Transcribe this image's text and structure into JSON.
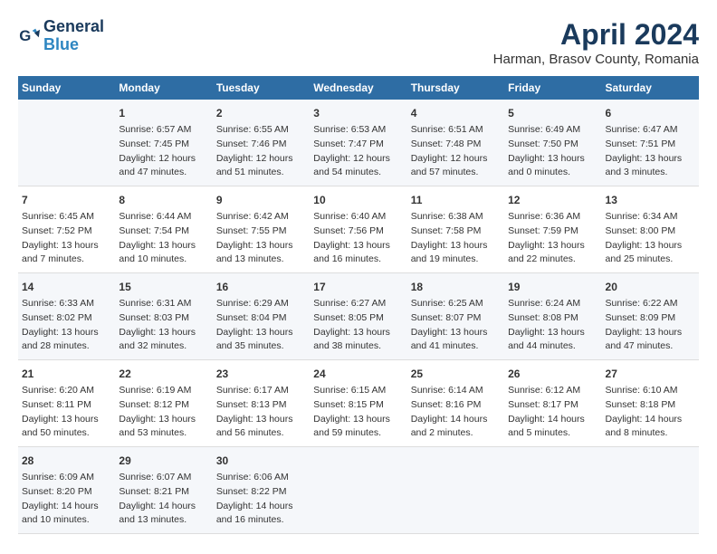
{
  "header": {
    "logo_line1": "General",
    "logo_line2": "Blue",
    "title": "April 2024",
    "subtitle": "Harman, Brasov County, Romania"
  },
  "days_of_week": [
    "Sunday",
    "Monday",
    "Tuesday",
    "Wednesday",
    "Thursday",
    "Friday",
    "Saturday"
  ],
  "weeks": [
    [
      {
        "day": "",
        "info": ""
      },
      {
        "day": "1",
        "info": "Sunrise: 6:57 AM\nSunset: 7:45 PM\nDaylight: 12 hours\nand 47 minutes."
      },
      {
        "day": "2",
        "info": "Sunrise: 6:55 AM\nSunset: 7:46 PM\nDaylight: 12 hours\nand 51 minutes."
      },
      {
        "day": "3",
        "info": "Sunrise: 6:53 AM\nSunset: 7:47 PM\nDaylight: 12 hours\nand 54 minutes."
      },
      {
        "day": "4",
        "info": "Sunrise: 6:51 AM\nSunset: 7:48 PM\nDaylight: 12 hours\nand 57 minutes."
      },
      {
        "day": "5",
        "info": "Sunrise: 6:49 AM\nSunset: 7:50 PM\nDaylight: 13 hours\nand 0 minutes."
      },
      {
        "day": "6",
        "info": "Sunrise: 6:47 AM\nSunset: 7:51 PM\nDaylight: 13 hours\nand 3 minutes."
      }
    ],
    [
      {
        "day": "7",
        "info": "Sunrise: 6:45 AM\nSunset: 7:52 PM\nDaylight: 13 hours\nand 7 minutes."
      },
      {
        "day": "8",
        "info": "Sunrise: 6:44 AM\nSunset: 7:54 PM\nDaylight: 13 hours\nand 10 minutes."
      },
      {
        "day": "9",
        "info": "Sunrise: 6:42 AM\nSunset: 7:55 PM\nDaylight: 13 hours\nand 13 minutes."
      },
      {
        "day": "10",
        "info": "Sunrise: 6:40 AM\nSunset: 7:56 PM\nDaylight: 13 hours\nand 16 minutes."
      },
      {
        "day": "11",
        "info": "Sunrise: 6:38 AM\nSunset: 7:58 PM\nDaylight: 13 hours\nand 19 minutes."
      },
      {
        "day": "12",
        "info": "Sunrise: 6:36 AM\nSunset: 7:59 PM\nDaylight: 13 hours\nand 22 minutes."
      },
      {
        "day": "13",
        "info": "Sunrise: 6:34 AM\nSunset: 8:00 PM\nDaylight: 13 hours\nand 25 minutes."
      }
    ],
    [
      {
        "day": "14",
        "info": "Sunrise: 6:33 AM\nSunset: 8:02 PM\nDaylight: 13 hours\nand 28 minutes."
      },
      {
        "day": "15",
        "info": "Sunrise: 6:31 AM\nSunset: 8:03 PM\nDaylight: 13 hours\nand 32 minutes."
      },
      {
        "day": "16",
        "info": "Sunrise: 6:29 AM\nSunset: 8:04 PM\nDaylight: 13 hours\nand 35 minutes."
      },
      {
        "day": "17",
        "info": "Sunrise: 6:27 AM\nSunset: 8:05 PM\nDaylight: 13 hours\nand 38 minutes."
      },
      {
        "day": "18",
        "info": "Sunrise: 6:25 AM\nSunset: 8:07 PM\nDaylight: 13 hours\nand 41 minutes."
      },
      {
        "day": "19",
        "info": "Sunrise: 6:24 AM\nSunset: 8:08 PM\nDaylight: 13 hours\nand 44 minutes."
      },
      {
        "day": "20",
        "info": "Sunrise: 6:22 AM\nSunset: 8:09 PM\nDaylight: 13 hours\nand 47 minutes."
      }
    ],
    [
      {
        "day": "21",
        "info": "Sunrise: 6:20 AM\nSunset: 8:11 PM\nDaylight: 13 hours\nand 50 minutes."
      },
      {
        "day": "22",
        "info": "Sunrise: 6:19 AM\nSunset: 8:12 PM\nDaylight: 13 hours\nand 53 minutes."
      },
      {
        "day": "23",
        "info": "Sunrise: 6:17 AM\nSunset: 8:13 PM\nDaylight: 13 hours\nand 56 minutes."
      },
      {
        "day": "24",
        "info": "Sunrise: 6:15 AM\nSunset: 8:15 PM\nDaylight: 13 hours\nand 59 minutes."
      },
      {
        "day": "25",
        "info": "Sunrise: 6:14 AM\nSunset: 8:16 PM\nDaylight: 14 hours\nand 2 minutes."
      },
      {
        "day": "26",
        "info": "Sunrise: 6:12 AM\nSunset: 8:17 PM\nDaylight: 14 hours\nand 5 minutes."
      },
      {
        "day": "27",
        "info": "Sunrise: 6:10 AM\nSunset: 8:18 PM\nDaylight: 14 hours\nand 8 minutes."
      }
    ],
    [
      {
        "day": "28",
        "info": "Sunrise: 6:09 AM\nSunset: 8:20 PM\nDaylight: 14 hours\nand 10 minutes."
      },
      {
        "day": "29",
        "info": "Sunrise: 6:07 AM\nSunset: 8:21 PM\nDaylight: 14 hours\nand 13 minutes."
      },
      {
        "day": "30",
        "info": "Sunrise: 6:06 AM\nSunset: 8:22 PM\nDaylight: 14 hours\nand 16 minutes."
      },
      {
        "day": "",
        "info": ""
      },
      {
        "day": "",
        "info": ""
      },
      {
        "day": "",
        "info": ""
      },
      {
        "day": "",
        "info": ""
      }
    ]
  ]
}
